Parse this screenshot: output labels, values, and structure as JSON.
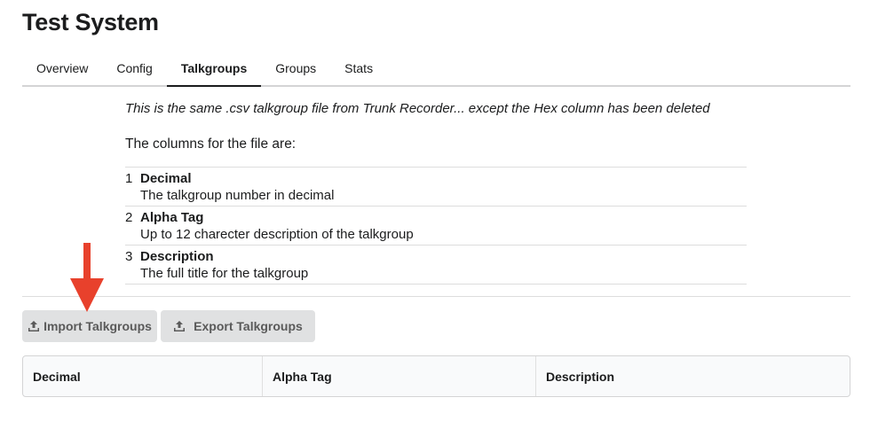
{
  "page": {
    "title": "Test System"
  },
  "tabs": [
    {
      "label": "Overview",
      "active": false
    },
    {
      "label": "Config",
      "active": false
    },
    {
      "label": "Talkgroups",
      "active": true
    },
    {
      "label": "Groups",
      "active": false
    },
    {
      "label": "Stats",
      "active": false
    }
  ],
  "content": {
    "intro": "This is the same .csv talkgroup file from Trunk Recorder... except the Hex column has been deleted",
    "columns_heading": "The columns for the file are:",
    "columns": [
      {
        "number": "1",
        "name": "Decimal",
        "description": "The talkgroup number in decimal"
      },
      {
        "number": "2",
        "name": "Alpha Tag",
        "description": "Up to 12 charecter description of the talkgroup"
      },
      {
        "number": "3",
        "name": "Description",
        "description": "The full title for the talkgroup"
      }
    ]
  },
  "actions": {
    "import_label": "Import Talkgroups",
    "export_label": "Export Talkgroups",
    "icon": "upload-icon"
  },
  "annotation": {
    "arrow_color": "#e8412c",
    "icon": "red-arrow-down-icon"
  },
  "table": {
    "headers": [
      "Decimal",
      "Alpha Tag",
      "Description"
    ]
  }
}
